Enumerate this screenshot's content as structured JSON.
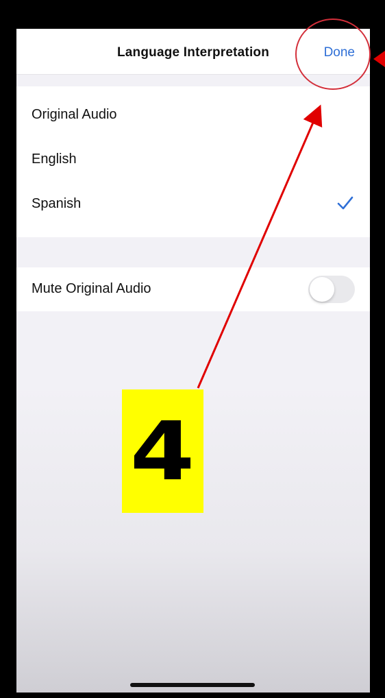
{
  "navbar": {
    "title": "Language Interpretation",
    "done_label": "Done"
  },
  "languages": [
    {
      "label": "Original Audio",
      "selected": false
    },
    {
      "label": "English",
      "selected": false
    },
    {
      "label": "Spanish",
      "selected": true
    }
  ],
  "mute_row": {
    "label": "Mute Original Audio",
    "toggle_on": false
  },
  "annotation": {
    "step_number": "4",
    "badge_color": "#ffff00",
    "arrow_color": "#e00000"
  },
  "colors": {
    "accent": "#2f6fd6",
    "background": "#f2f1f6"
  }
}
